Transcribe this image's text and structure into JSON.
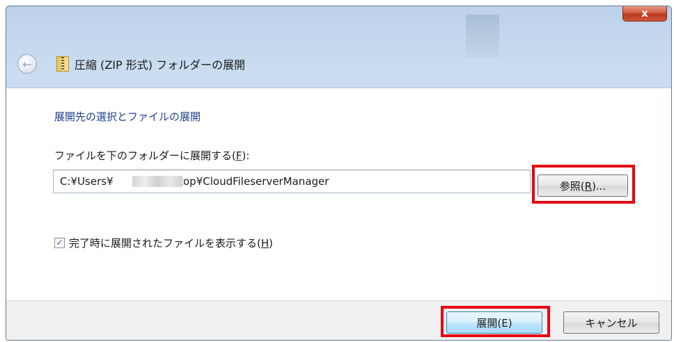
{
  "window": {
    "close_label": "x",
    "title": "圧縮 (ZIP 形式) フォルダーの展開",
    "back_glyph": "←"
  },
  "content": {
    "heading": "展開先の選択とファイルの展開",
    "field_label_prefix": "ファイルを下のフォルダーに展開する(",
    "field_label_key": "F",
    "field_label_suffix": "):",
    "path_value": "C:¥Users¥          ¥Desktop¥CloudFileserverManager",
    "browse_prefix": "参照(",
    "browse_key": "R",
    "browse_suffix": ")...",
    "checkbox_checked": true,
    "checkbox_mark": "✓",
    "checkbox_label_prefix": "完了時に展開されたファイルを表示する(",
    "checkbox_label_key": "H",
    "checkbox_label_suffix": ")"
  },
  "footer": {
    "extract_label": "展開(E)",
    "cancel_label": "キャンセル"
  },
  "colors": {
    "highlight": "#e60012",
    "heading": "#1e3f8f"
  }
}
